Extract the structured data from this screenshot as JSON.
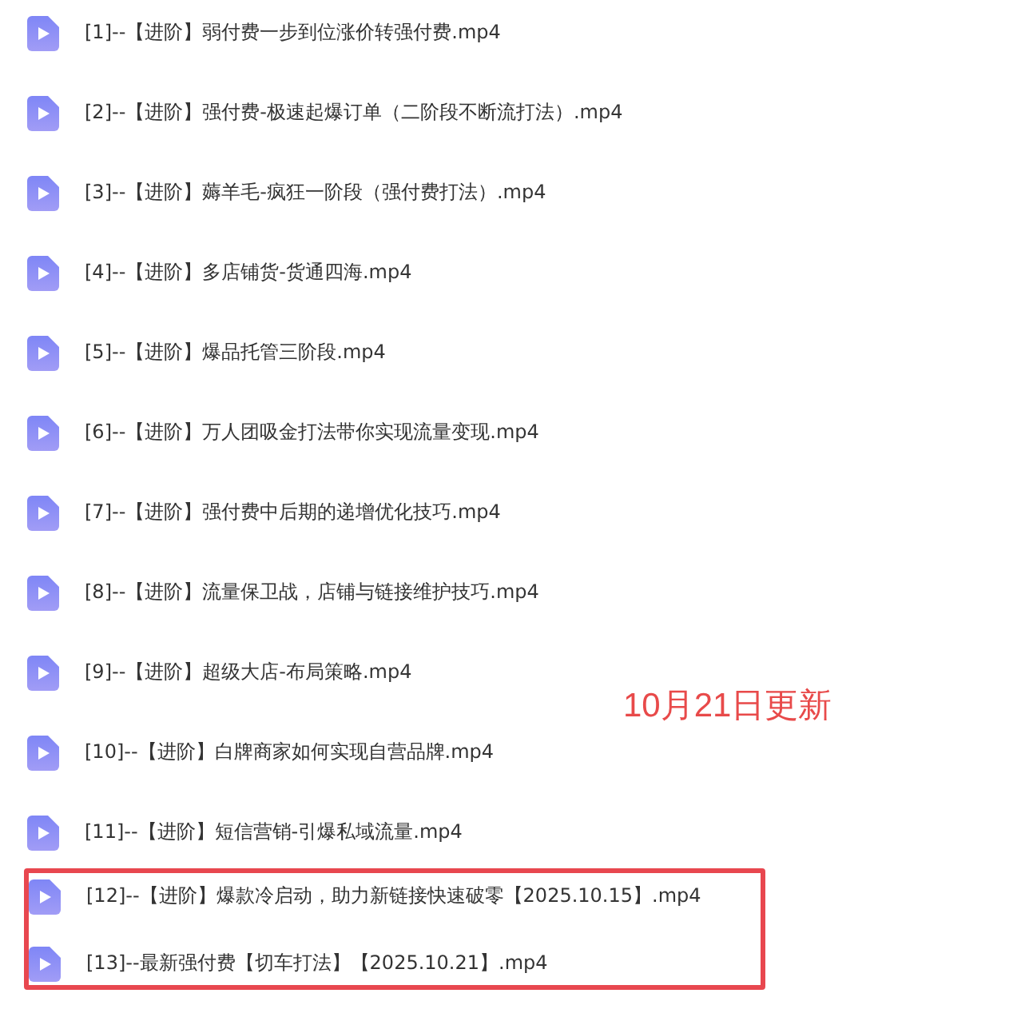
{
  "files": [
    {
      "name": "[1]--【进阶】弱付费一步到位涨价转强付费.mp4",
      "highlighted": false
    },
    {
      "name": "[2]--【进阶】强付费-极速起爆订单（二阶段不断流打法）.mp4",
      "highlighted": false
    },
    {
      "name": "[3]--【进阶】薅羊毛-疯狂一阶段（强付费打法）.mp4",
      "highlighted": false
    },
    {
      "name": "[4]--【进阶】多店铺货-货通四海.mp4",
      "highlighted": false
    },
    {
      "name": "[5]--【进阶】爆品托管三阶段.mp4",
      "highlighted": false
    },
    {
      "name": "[6]--【进阶】万人团吸金打法带你实现流量变现.mp4",
      "highlighted": false
    },
    {
      "name": "[7]--【进阶】强付费中后期的递增优化技巧.mp4",
      "highlighted": false
    },
    {
      "name": "[8]--【进阶】流量保卫战，店铺与链接维护技巧.mp4",
      "highlighted": false
    },
    {
      "name": "[9]--【进阶】超级大店-布局策略.mp4",
      "highlighted": false
    },
    {
      "name": "[10]--【进阶】白牌商家如何实现自营品牌.mp4",
      "highlighted": false
    },
    {
      "name": "[11]--【进阶】短信营销-引爆私域流量.mp4",
      "highlighted": false
    },
    {
      "name": "[12]--【进阶】爆款冷启动，助力新链接快速破零【2025.10.15】.mp4",
      "highlighted": true
    },
    {
      "name": "[13]--最新强付费【切车打法】【2025.10.21】.mp4",
      "highlighted": true
    }
  ],
  "annotation": "10月21日更新"
}
